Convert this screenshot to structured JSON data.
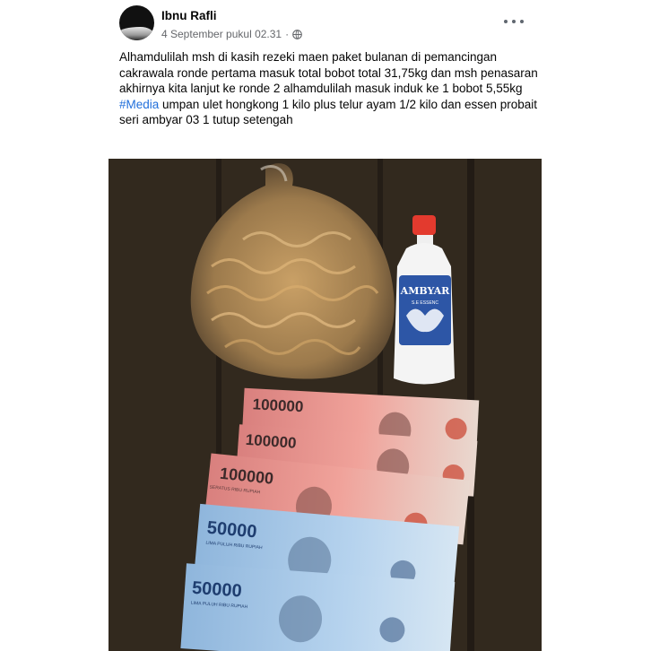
{
  "post": {
    "author": "Ibnu Rafli",
    "timestamp": "4 September pukul 02.31",
    "separator": "·",
    "privacy_icon": "globe-icon",
    "more_icon": "more-horizontal-icon",
    "paragraph1": "Alhamdulilah msh di kasih rezeki maen paket bulanan di pemancingan cakrawala ronde pertama masuk total bobot total 31,75kg dan msh penasaran akhirnya kita lanjut ke ronde 2 alhamdulilah masuk induk ke 1 bobot 5,55kg",
    "hashtag": "#Media",
    "paragraph2": " umpan ulet hongkong 1 kilo plus telur ayam 1/2 kilo dan essen probait seri ambyar 03 1 tutup setengah"
  },
  "photo": {
    "bottle_label": "AMBYAR",
    "bottle_sub": "S.E ESSENC",
    "notes": [
      {
        "amount": "100000",
        "type": "red"
      },
      {
        "amount": "100000",
        "type": "red"
      },
      {
        "amount": "100000",
        "type": "red",
        "caption": "SERATUS RIBU RUPIAH"
      },
      {
        "amount": "50000",
        "type": "blue",
        "caption": "LIMA PULUH RIBU RUPIAH"
      },
      {
        "amount": "50000",
        "type": "blue",
        "caption": "LIMA PULUH RIBU RUPIAH"
      }
    ],
    "colors": {
      "red_note": "#e98a86",
      "blue_note": "#9cc3e8",
      "wood": "#2f271d"
    }
  }
}
